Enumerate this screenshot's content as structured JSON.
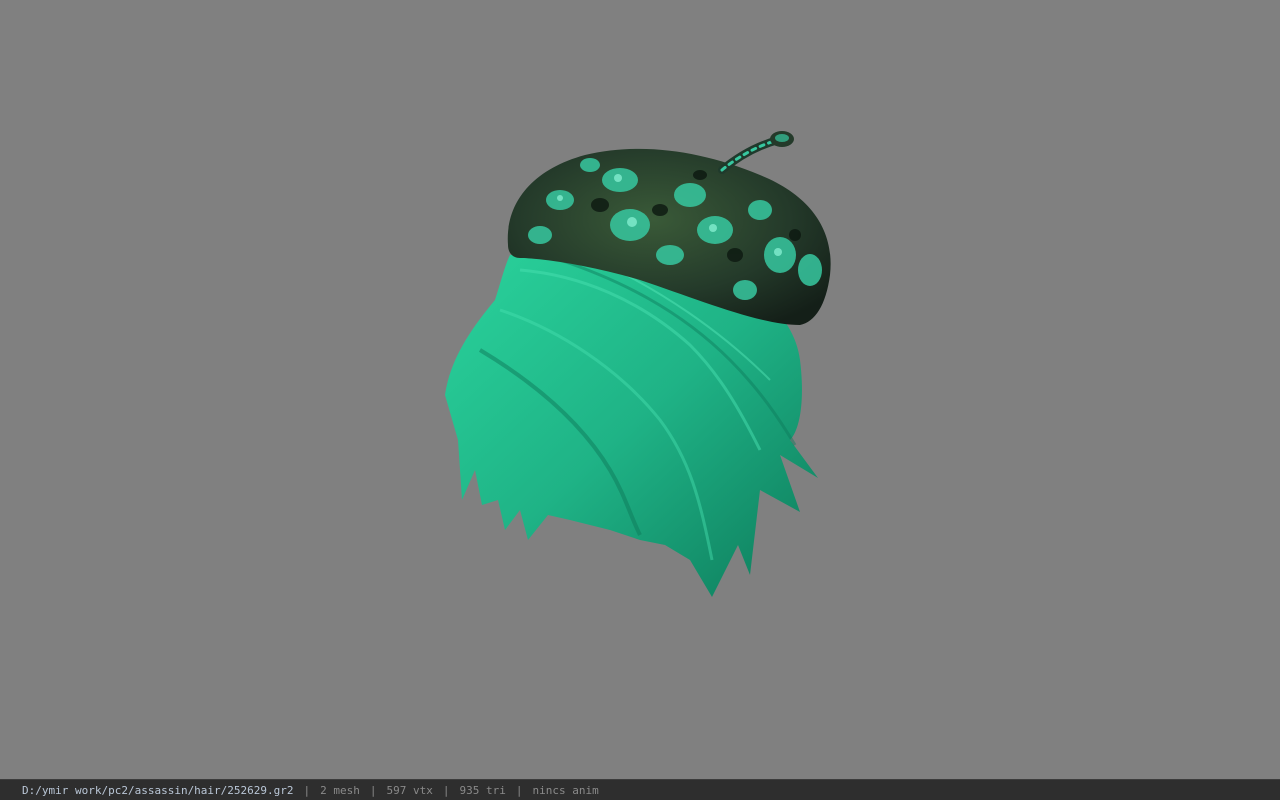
{
  "viewer": {
    "background_color": "#808080",
    "model": {
      "hat_icon": "beret-mesh-icon",
      "hair_icon": "hair-mesh-icon",
      "hat_base_color": "#1f3a2c",
      "hat_spot_color": "#37c8a0",
      "hair_color": "#1fb386",
      "hair_highlight": "#48e0b0",
      "hair_shadow": "#0d7a5a"
    }
  },
  "status_bar": {
    "file_path": "D:/ymir work/pc2/assassin/hair/252629.gr2",
    "separator": "|",
    "mesh_count": "2 mesh",
    "vertex_count": "597 vtx",
    "triangle_count": "935 tri",
    "anim_info": "nincs anim"
  }
}
